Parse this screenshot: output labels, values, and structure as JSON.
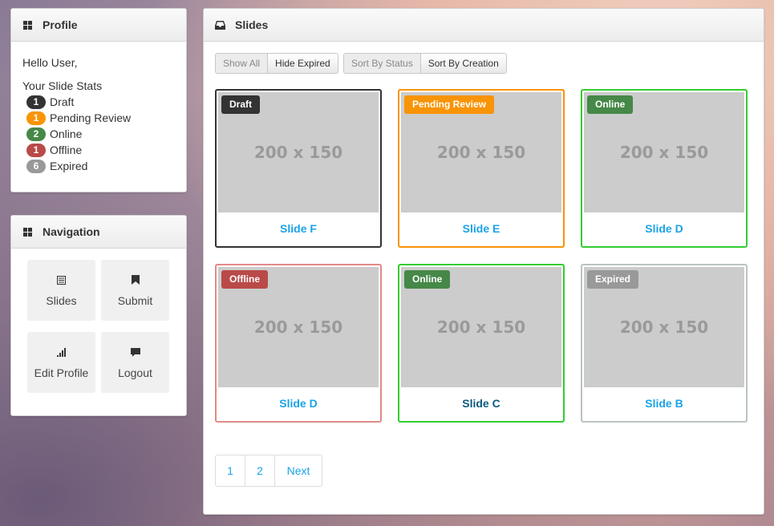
{
  "profile": {
    "title": "Profile",
    "greeting": "Hello User,",
    "stats_heading": "Your Slide Stats",
    "stats": [
      {
        "count": "1",
        "label": "Draft",
        "color": "#333333"
      },
      {
        "count": "1",
        "label": "Pending Review",
        "color": "#f89406"
      },
      {
        "count": "2",
        "label": "Online",
        "color": "#468847"
      },
      {
        "count": "1",
        "label": "Offline",
        "color": "#b94a48"
      },
      {
        "count": "6",
        "label": "Expired",
        "color": "#999999"
      }
    ]
  },
  "navigation": {
    "title": "Navigation",
    "tiles": [
      {
        "label": "Slides",
        "icon": "list-icon"
      },
      {
        "label": "Submit",
        "icon": "bookmark-icon"
      },
      {
        "label": "Edit Profile",
        "icon": "signal-icon"
      },
      {
        "label": "Logout",
        "icon": "comment-icon"
      }
    ]
  },
  "slides": {
    "title": "Slides",
    "filter_buttons": [
      "Show All",
      "Hide Expired"
    ],
    "sort_buttons": [
      "Sort By Status",
      "Sort By Creation"
    ],
    "placeholder_text": "200 x 150",
    "cards": [
      {
        "status": "Draft",
        "title": "Slide F",
        "color": "#333333",
        "border": "#333333"
      },
      {
        "status": "Pending Review",
        "title": "Slide E",
        "color": "#f89406",
        "border": "#f89406"
      },
      {
        "status": "Online",
        "title": "Slide D",
        "color": "#468847",
        "border": "#33cc33"
      },
      {
        "status": "Offline",
        "title": "Slide D",
        "color": "#b94a48",
        "border": "#e08a88"
      },
      {
        "status": "Online",
        "title": "Slide C",
        "color": "#468847",
        "border": "#33cc33"
      },
      {
        "status": "Expired",
        "title": "Slide B",
        "color": "#999999",
        "border": "#b8c4c0"
      }
    ],
    "pagination": [
      "1",
      "2",
      "Next"
    ]
  }
}
